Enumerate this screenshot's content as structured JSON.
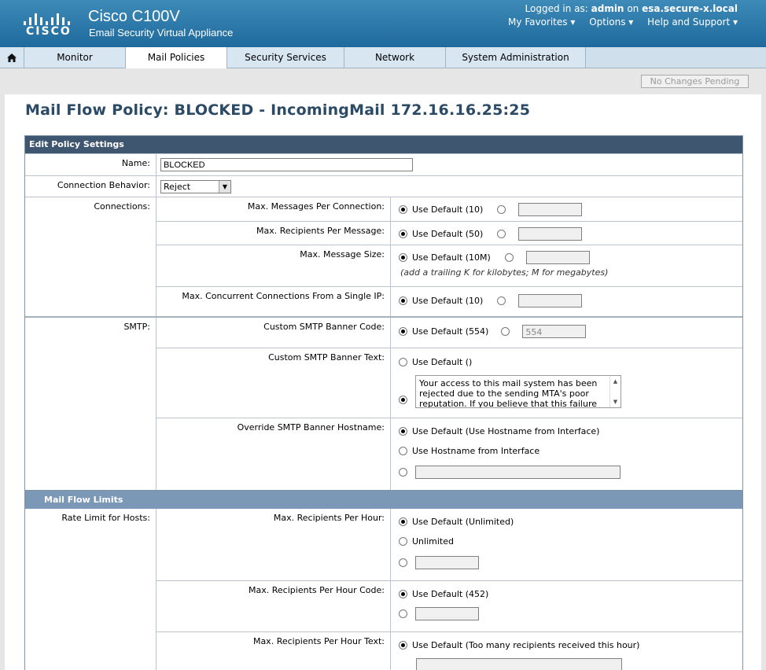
{
  "header": {
    "product_title": "Cisco C100V",
    "product_subtitle": "Email Security Virtual Appliance",
    "logo_text": "CISCO",
    "logged_in_label": "Logged in as:",
    "user": "admin",
    "on_label": "on",
    "host": "esa.secure-x.local",
    "util_links": [
      "My Favorites ▾",
      "Options ▾",
      "Help and Support ▾"
    ]
  },
  "nav": {
    "tabs": [
      "Monitor",
      "Mail Policies",
      "Security Services",
      "Network",
      "System Administration"
    ],
    "active": "Mail Policies"
  },
  "status_button": "No Changes Pending",
  "page_title": "Mail Flow Policy: BLOCKED - IncomingMail 172.16.16.25:25",
  "edit_section": {
    "title": "Edit Policy Settings",
    "name_label": "Name:",
    "name_value": "BLOCKED",
    "behavior_label": "Connection Behavior:",
    "behavior_value": "Reject",
    "connections_label": "Connections:",
    "max_msgs_label": "Max. Messages Per Connection:",
    "max_msgs_default": "Use Default (10)",
    "max_rcpts_label": "Max. Recipients Per Message:",
    "max_rcpts_default": "Use Default (50)",
    "max_size_label": "Max. Message Size:",
    "max_size_default": "Use Default (10M)",
    "max_size_hint": "(add a trailing K for kilobytes; M for megabytes)",
    "max_conc_label": "Max. Concurrent Connections From a Single IP:",
    "max_conc_default": "Use Default (10)",
    "smtp_label": "SMTP:",
    "banner_code_label": "Custom SMTP Banner Code:",
    "banner_code_default": "Use Default (554)",
    "banner_code_value": "554",
    "banner_text_label": "Custom SMTP Banner Text:",
    "banner_text_default": "Use Default ()",
    "banner_text_value": "Your access to this mail system has been rejected due to the sending MTA's poor reputation. If you believe that this failure",
    "hostname_label": "Override SMTP Banner Hostname:",
    "hostname_default": "Use Default (Use Hostname from Interface)",
    "hostname_option": "Use Hostname from Interface"
  },
  "limits_section": {
    "title": "Mail Flow Limits",
    "rate_label": "Rate Limit for Hosts:",
    "rph_label": "Max. Recipients Per Hour:",
    "rph_default": "Use Default (Unlimited)",
    "rph_unlimited": "Unlimited",
    "rph_code_label": "Max. Recipients Per Hour Code:",
    "rph_code_default": "Use Default (452)",
    "rph_text_label": "Max. Recipients Per Hour Text:",
    "rph_text_default": "Use Default (Too many recipients received this hour)"
  }
}
